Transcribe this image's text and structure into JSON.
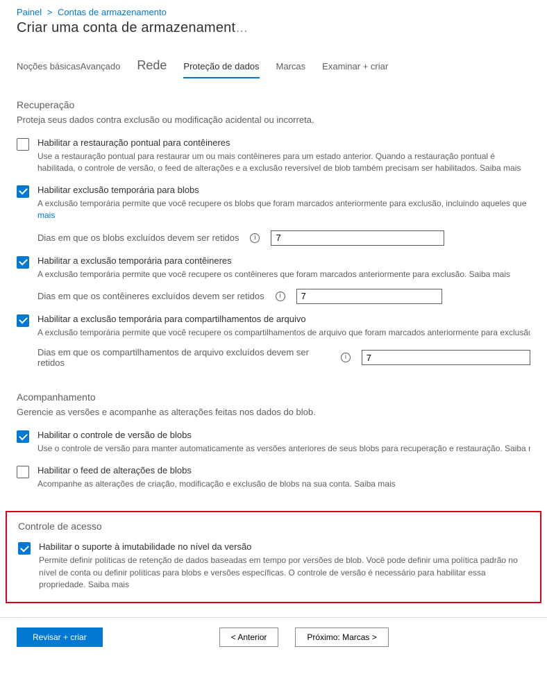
{
  "breadcrumb": {
    "root": "Painel",
    "sep": ">",
    "link": "Contas de armazenamento"
  },
  "title": "Criar uma conta de armazenament",
  "title_dots": "…",
  "tabs": {
    "basics": "Noções básicas",
    "advanced": "Avançado",
    "network": "Rede",
    "data_protection": "Proteção de dados",
    "tags": "Marcas",
    "review": "Examinar + criar"
  },
  "recovery": {
    "heading": "Recuperação",
    "desc": "Proteja seus dados contra exclusão ou modificação acidental ou incorreta.",
    "pitr": {
      "label": "Habilitar a restauração pontual para contêineres",
      "hint": "Use a restauração pontual para restaurar um ou mais contêineres para um estado anterior. Quando a restauração pontual é habilitada, o controle de versão, o feed de alterações e a exclusão reversível de blob também precisam ser habilitados. Saiba mais"
    },
    "soft_blob": {
      "label": "Habilitar exclusão temporária para blobs",
      "hint": "A exclusão temporária permite que você recupere os blobs que foram marcados anteriormente para exclusão, incluindo aqueles que",
      "more": "mais",
      "days_label": "Dias em que os blobs excluídos devem ser retidos",
      "days_value": "7"
    },
    "soft_container": {
      "label": "Habilitar a exclusão temporária para contêineres",
      "hint": "A exclusão temporária permite que você recupere os contêineres que foram marcados anteriormente para exclusão. Saiba mais",
      "days_label_a": "Dias em que os contêineres excluídos devem ser retidos",
      "days_value": "7"
    },
    "soft_share": {
      "label": "Habilitar a exclusão temporária para compartilhamentos de arquivo",
      "hint": "A exclusão temporária permite que você recupere os compartilhamentos de arquivo que foram marcados anteriormente para exclusão. Saiba mais",
      "days_label": "Dias em que os compartilhamentos de arquivo excluídos devem ser retidos",
      "days_value": "7"
    }
  },
  "tracking": {
    "heading": "Acompanhamento",
    "desc": "Gerencie as versões e acompanhe as alterações feitas nos dados do blob.",
    "versioning": {
      "label": "Habilitar o controle de versão de blobs",
      "hint": "Use o controle de versão para manter automaticamente as versões anteriores de seus blobs para recuperação e restauração. Saiba mais"
    },
    "changefeed": {
      "label": "Habilitar o feed de alterações de blobs",
      "hint": "Acompanhe as alterações de criação, modificação e exclusão de blobs na sua conta. Saiba mais"
    }
  },
  "access": {
    "heading": "Controle de acesso",
    "immutability": {
      "label": "Habilitar o suporte à imutabilidade no nível da versão",
      "hint": "Permite definir políticas de retenção de dados baseadas em tempo por versões de blob. Você pode definir uma política padrão no nível de conta ou definir políticas para blobs e versões específicas. O controle de versão é necessário para habilitar essa propriedade. Saiba mais"
    }
  },
  "footer": {
    "review": "Revisar + criar",
    "previous": "< Anterior",
    "next": "Próximo: Marcas >"
  }
}
